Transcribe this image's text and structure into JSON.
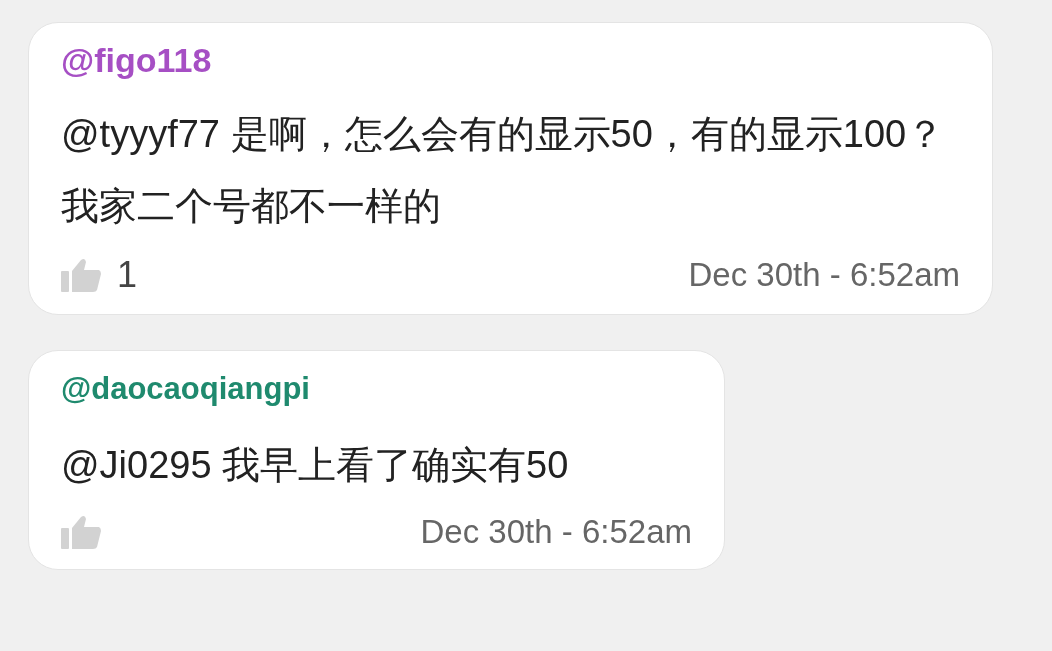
{
  "comments": [
    {
      "username": "@figo118",
      "color": "#a64fc4",
      "text": "@tyyyf77 是啊，怎么会有的显示50，有的显示100？我家二个号都不一样的",
      "likes": "1",
      "date": "Dec 30th - 6:52am"
    },
    {
      "username": "@daocaoqiangpi",
      "color": "#1f8a6e",
      "text": "@Ji0295 我早上看了确实有50",
      "date": "Dec 30th - 6:52am"
    }
  ]
}
